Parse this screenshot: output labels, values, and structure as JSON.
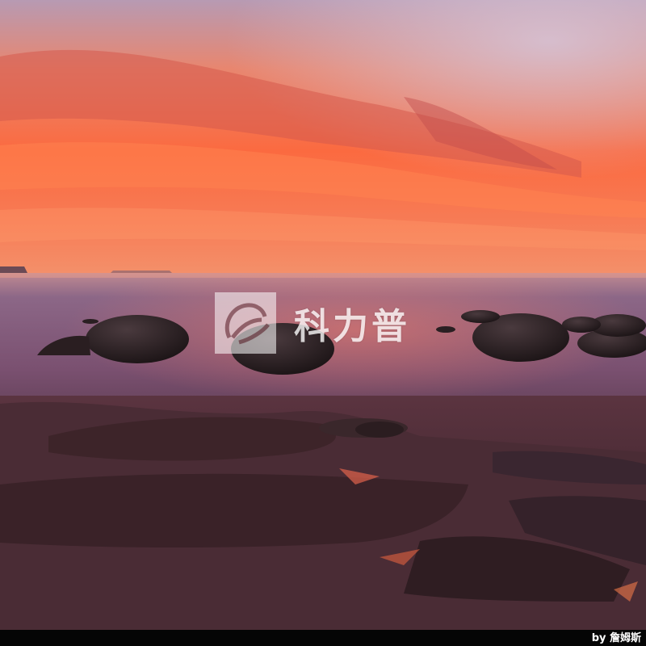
{
  "photo": {
    "subject": "sunset-boulder-beach",
    "colors": {
      "sky_top": "#c9b4c6",
      "sky_glow": "#ff6a3c",
      "horizon": "#f4815a",
      "sea": "#7f5a78",
      "rock": "#3a2a30"
    }
  },
  "watermark": {
    "text": "科力普",
    "icon": "kelipu-logo-icon"
  },
  "credit": {
    "text": "by 詹姆斯"
  }
}
